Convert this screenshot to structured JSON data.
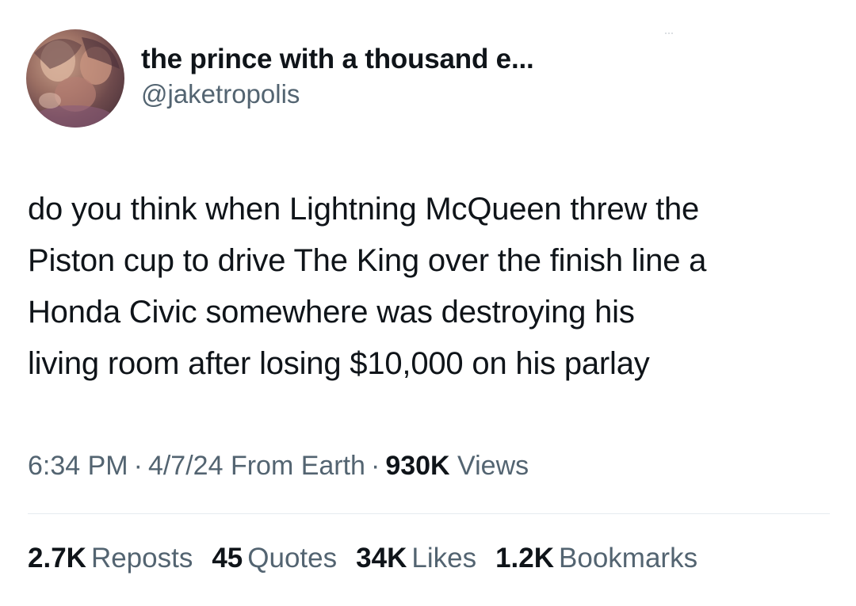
{
  "author": {
    "display_name": "the prince with a thousand e...",
    "handle": "@jaketropolis"
  },
  "tweet": {
    "text": "do you think when Lightning McQueen threw the\nPiston cup to drive The King over the finish line a\nHonda Civic somewhere was destroying his\nliving room after losing $10,000 on his parlay"
  },
  "meta": {
    "time": "6:34 PM",
    "separator": "·",
    "date": "4/7/24",
    "source": "From Earth",
    "views_count": "930K",
    "views_label": "Views"
  },
  "stats": {
    "reposts": {
      "count": "2.7K",
      "label": "Reposts"
    },
    "quotes": {
      "count": "45",
      "label": "Quotes"
    },
    "likes": {
      "count": "34K",
      "label": "Likes"
    },
    "bookmarks": {
      "count": "1.2K",
      "label": "Bookmarks"
    }
  },
  "colors": {
    "text_primary": "#0f1419",
    "text_secondary": "#536471",
    "divider": "#e6ecf0",
    "background": "#ffffff"
  },
  "icons": {
    "more": "more-dots-icon"
  }
}
